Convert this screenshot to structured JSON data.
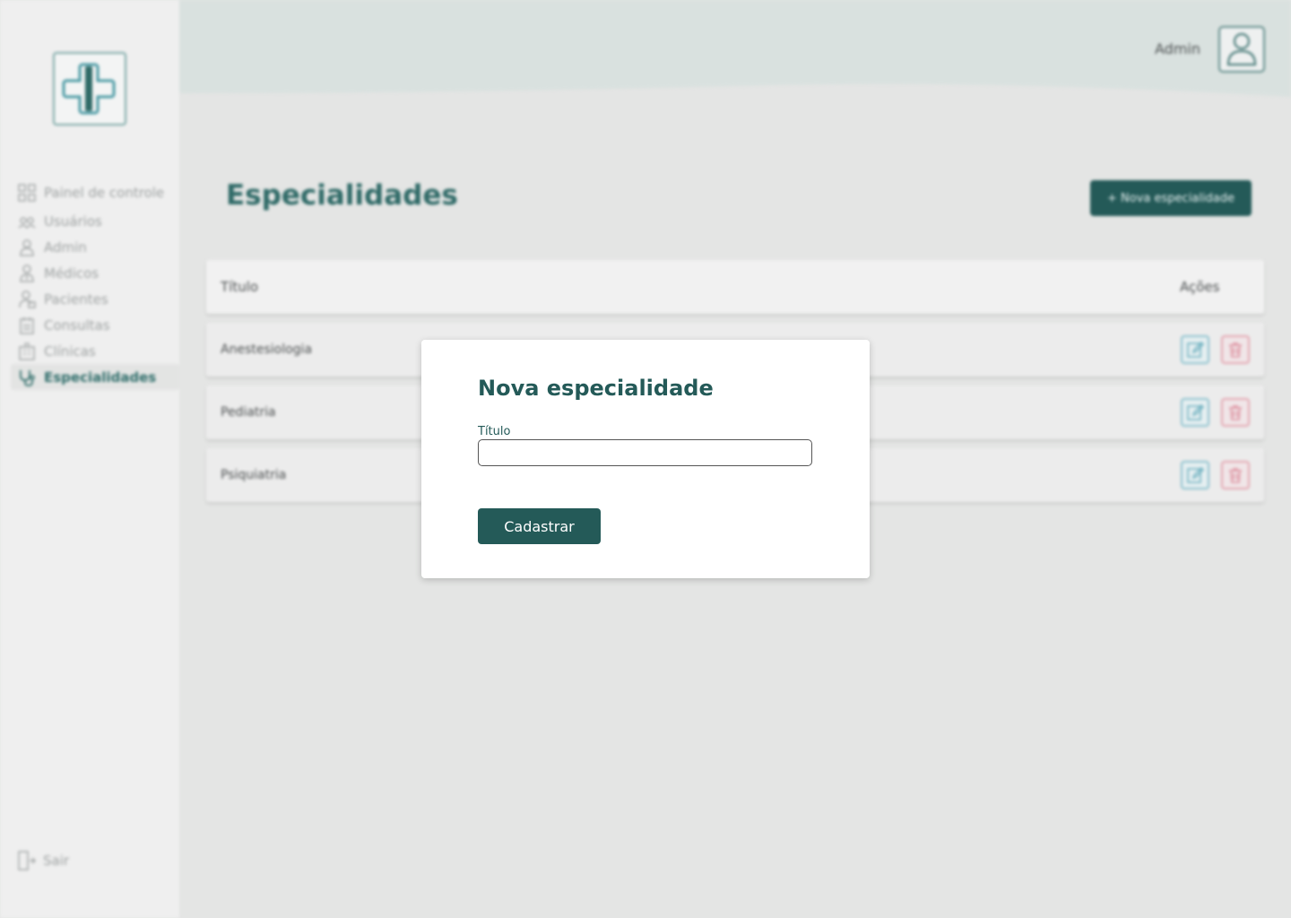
{
  "sidebar": {
    "items": [
      {
        "label": "Painel de controle",
        "icon": "dashboard-icon"
      },
      {
        "label": "Usuários",
        "icon": "users-icon"
      },
      {
        "label": "Admin",
        "icon": "admin-icon"
      },
      {
        "label": "Médicos",
        "icon": "doctor-icon"
      },
      {
        "label": "Pacientes",
        "icon": "patient-icon"
      },
      {
        "label": "Consultas",
        "icon": "appointment-icon"
      },
      {
        "label": "Clínicas",
        "icon": "clinic-icon"
      },
      {
        "label": "Especialidades",
        "icon": "stethoscope-icon",
        "active": true
      }
    ],
    "logout_label": "Sair"
  },
  "header": {
    "user_name": "Admin"
  },
  "main": {
    "title": "Especialidades",
    "new_button_label": "+ Nova especialidade",
    "table": {
      "columns": [
        "Título",
        "Ações"
      ],
      "rows": [
        "Anestesiologia",
        "Pediatria",
        "Psiquiatria"
      ]
    }
  },
  "modal": {
    "title": "Nova especialidade",
    "field_label": "Título",
    "field_value": "",
    "submit_label": "Cadastrar"
  },
  "colors": {
    "primary": "#245a58",
    "edit_accent": "#8cc1cd",
    "delete_accent": "#e4a6b1"
  }
}
